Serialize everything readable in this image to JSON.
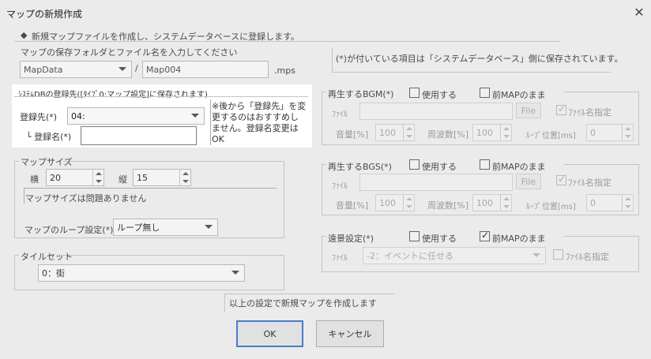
{
  "window": {
    "title": "マップの新規作成",
    "close_glyph": "✕"
  },
  "info": {
    "bullet": "◆",
    "text": "新規マップファイルを作成し、システムデータベースに登録します。"
  },
  "save_folder": {
    "legend": "マップの保存フォルダとファイル名を入力してください",
    "folder": "MapData",
    "separator": "/",
    "filename": "Map004",
    "extension": ".mps"
  },
  "note_top": "(*)が付いている項目は「システムデータベース」側に保存されています。",
  "db_register": {
    "legend": "ｼｽﾃﾑDBの登録先([ﾀｲﾌﾟ0:マップ設定]に保存されます)",
    "target_label": "登録先(*)",
    "target_value": "04:",
    "name_label": "└ 登録名(*)",
    "name_value": "",
    "note": "※後から「登録先」を変更するのはおすすめしません。登録名変更はOK"
  },
  "bgm": {
    "legend": "再生するBGM(*)",
    "use_label": "使用する",
    "keep_label": "前MAPのまま",
    "use_checked": false,
    "keep_checked": false,
    "file_label": "ﾌｧｲﾙ",
    "file_value": "",
    "file_button": "File",
    "name_spec_label": "ﾌｧｲﾙ名指定",
    "name_spec_checked": true,
    "volume_label": "音量[%]",
    "volume": "100",
    "freq_label": "周波数[%]",
    "freq": "100",
    "loop_label": "ﾙｰﾌﾟ位置[ms]",
    "loop": "0"
  },
  "bgs": {
    "legend": "再生するBGS(*)",
    "use_label": "使用する",
    "keep_label": "前MAPのまま",
    "use_checked": false,
    "keep_checked": false,
    "file_label": "ﾌｧｲﾙ",
    "file_value": "",
    "file_button": "File",
    "name_spec_label": "ﾌｧｲﾙ名指定",
    "name_spec_checked": true,
    "volume_label": "音量[%]",
    "volume": "100",
    "freq_label": "周波数[%]",
    "freq": "100",
    "loop_label": "ﾙｰﾌﾟ位置[ms]",
    "loop": "0"
  },
  "panorama": {
    "legend": "遠景設定(*)",
    "use_label": "使用する",
    "keep_label": "前MAPのまま",
    "use_checked": false,
    "keep_checked": true,
    "file_label": "ﾌｧｲﾙ",
    "file_value": "-2：イベントに任せる",
    "name_spec_label": "ﾌｧｲﾙ名指定",
    "name_spec_checked": false
  },
  "map_size": {
    "legend": "マップサイズ",
    "width_label": "横",
    "width": "20",
    "height_label": "縦",
    "height": "15",
    "note": "マップサイズは問題ありません",
    "loop_label": "マップのループ設定(*)",
    "loop_value": "ループ無し"
  },
  "tileset": {
    "legend": "タイルセット",
    "value": "0：街"
  },
  "footer": {
    "note": "以上の設定で新規マップを作成します",
    "ok": "OK",
    "cancel": "キャンセル"
  }
}
